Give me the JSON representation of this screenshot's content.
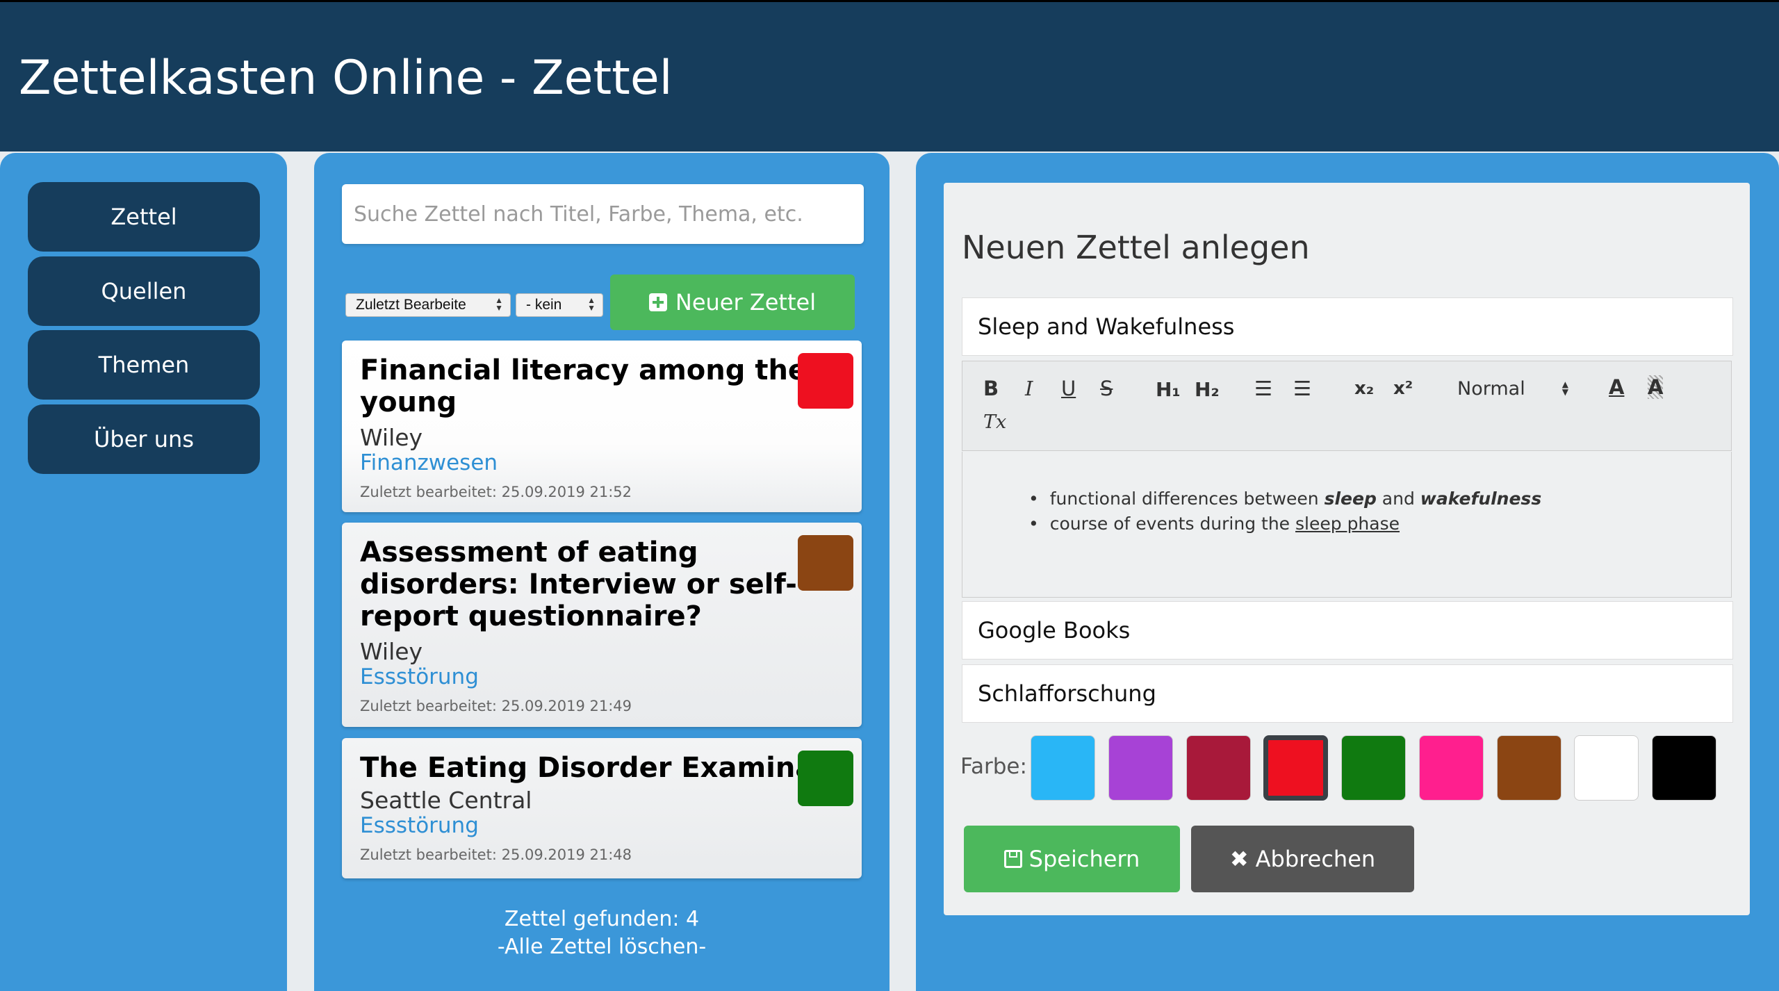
{
  "header": {
    "title": "Zettelkasten Online - Zettel"
  },
  "nav": {
    "items": [
      {
        "label": "Zettel"
      },
      {
        "label": "Quellen"
      },
      {
        "label": "Themen"
      },
      {
        "label": "Über uns"
      }
    ]
  },
  "list": {
    "search_placeholder": "Suche Zettel nach Titel, Farbe, Thema, etc.",
    "sort_value": "Zuletzt Bearbeite",
    "filter_value": "- kein",
    "new_button": "Neuer Zettel",
    "cards": [
      {
        "title": "Financial literacy among the young",
        "source": "Wiley",
        "topic": "Finanzwesen",
        "date": "Zuletzt bearbeitet: 25.09.2019 21:52",
        "color": "#ee1020"
      },
      {
        "title": "Assessment of eating disorders: Interview or self-report questionnaire?",
        "source": "Wiley",
        "topic": "Essstörung",
        "date": "Zuletzt bearbeitet: 25.09.2019 21:49",
        "color": "#8b4513"
      },
      {
        "title": "The Eating Disorder Examination",
        "source": "Seattle Central",
        "topic": "Essstörung",
        "date": "Zuletzt bearbeitet: 25.09.2019 21:48",
        "color": "#107a10"
      }
    ],
    "found_text": "Zettel gefunden: 4",
    "delete_all": "-Alle Zettel löschen-"
  },
  "editor": {
    "heading": "Neuen Zettel anlegen",
    "title_value": "Sleep and Wakefulness",
    "toolbar": {
      "bold": "B",
      "italic": "I",
      "underline": "U",
      "strike": "S",
      "h1": "H₁",
      "h2": "H₂",
      "ordered": "☰",
      "bullet": "☰",
      "sub": "x₂",
      "sup": "x²",
      "format": "Normal",
      "color": "A",
      "background": "A",
      "clean": "Tx"
    },
    "content": {
      "l1_a": "functional differences between ",
      "l1_b": "sleep",
      "l1_c": " and ",
      "l1_d": "wakefulness",
      "l2_a": "course of events during the ",
      "l2_b": "sleep phase"
    },
    "source_value": "Google Books",
    "topic_value": "Schlafforschung",
    "color_label": "Farbe:",
    "colors": [
      "#29b6f6",
      "#a742d6",
      "#a8193a",
      "#ee1020",
      "#107a10",
      "#ff1f8e",
      "#8b4513",
      "#ffffff",
      "#000000"
    ],
    "selected_color": "#ee1020",
    "save_label": "Speichern",
    "cancel_label": "Abbrechen"
  }
}
